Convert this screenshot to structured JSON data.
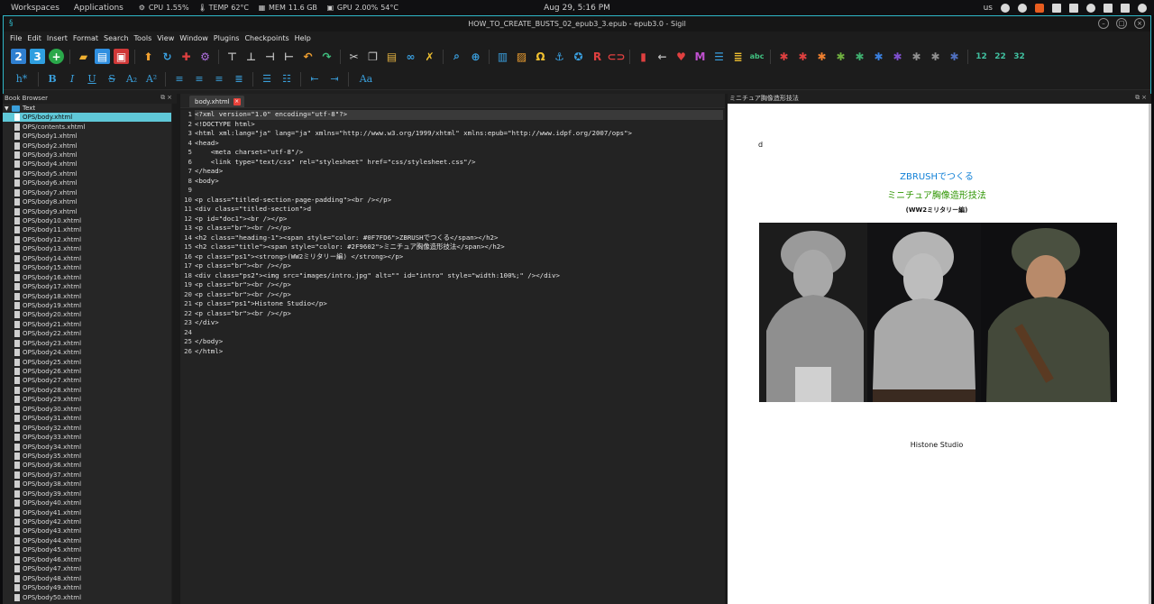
{
  "sysbar": {
    "workspaces": "Workspaces",
    "applications": "Applications",
    "cpu_label": "CPU",
    "cpu_value": "1.55%",
    "temp_label": "TEMP",
    "temp_value": "62°C",
    "mem_label": "MEM",
    "mem_value": "11.6 GB",
    "gpu_label": "GPU",
    "gpu_value": "2.00%",
    "gpu_temp": "54°C",
    "clock": "Aug 29, 5:16 PM",
    "keyboard": "us"
  },
  "window": {
    "title": "HOW_TO_CREATE_BUSTS_02_epub3_3.epub - epub3.0 - Sigil"
  },
  "menu": [
    "File",
    "Edit",
    "Insert",
    "Format",
    "Search",
    "Tools",
    "View",
    "Window",
    "Plugins",
    "Checkpoints",
    "Help"
  ],
  "toolbar2": {
    "heading": "h*",
    "bold": "B",
    "italic": "I",
    "underline": "U",
    "strike": "S",
    "sub": "A₂",
    "sup": "A²",
    "case": "Aa"
  },
  "bookbrowser": {
    "title": "Book Browser",
    "folder": "Text",
    "files": [
      "OPS/body.xhtml",
      "OPS/contents.xhtml",
      "OPS/body1.xhtml",
      "OPS/body2.xhtml",
      "OPS/body3.xhtml",
      "OPS/body4.xhtml",
      "OPS/body5.xhtml",
      "OPS/body6.xhtml",
      "OPS/body7.xhtml",
      "OPS/body8.xhtml",
      "OPS/body9.xhtml",
      "OPS/body10.xhtml",
      "OPS/body11.xhtml",
      "OPS/body12.xhtml",
      "OPS/body13.xhtml",
      "OPS/body14.xhtml",
      "OPS/body15.xhtml",
      "OPS/body16.xhtml",
      "OPS/body17.xhtml",
      "OPS/body18.xhtml",
      "OPS/body19.xhtml",
      "OPS/body20.xhtml",
      "OPS/body21.xhtml",
      "OPS/body22.xhtml",
      "OPS/body23.xhtml",
      "OPS/body24.xhtml",
      "OPS/body25.xhtml",
      "OPS/body26.xhtml",
      "OPS/body27.xhtml",
      "OPS/body28.xhtml",
      "OPS/body29.xhtml",
      "OPS/body30.xhtml",
      "OPS/body31.xhtml",
      "OPS/body32.xhtml",
      "OPS/body33.xhtml",
      "OPS/body34.xhtml",
      "OPS/body35.xhtml",
      "OPS/body36.xhtml",
      "OPS/body37.xhtml",
      "OPS/body38.xhtml",
      "OPS/body39.xhtml",
      "OPS/body40.xhtml",
      "OPS/body41.xhtml",
      "OPS/body42.xhtml",
      "OPS/body43.xhtml",
      "OPS/body44.xhtml",
      "OPS/body45.xhtml",
      "OPS/body46.xhtml",
      "OPS/body47.xhtml",
      "OPS/body48.xhtml",
      "OPS/body49.xhtml",
      "OPS/body50.xhtml"
    ],
    "selected_index": 0
  },
  "editor": {
    "tab_label": "body.xhtml",
    "current_line": 1,
    "lines": [
      "<?xml version=\"1.0\" encoding=\"utf-8\"?>",
      "<!DOCTYPE html>",
      "<html xml:lang=\"ja\" lang=\"ja\" xmlns=\"http://www.w3.org/1999/xhtml\" xmlns:epub=\"http://www.idpf.org/2007/ops\">",
      "<head>",
      "    <meta charset=\"utf-8\"/>",
      "    <link type=\"text/css\" rel=\"stylesheet\" href=\"css/stylesheet.css\"/>",
      "</head>",
      "<body>",
      "",
      "<p class=\"titled-section-page-padding\"><br /></p>",
      "<div class=\"titled-section\">d",
      "<p id=\"doc1\"><br /></p>",
      "<p class=\"br\"><br /></p>",
      "<h2 class=\"heading-1\"><span style=\"color: #0F7FD6\">ZBRUSHでつくる</span></h2>",
      "<h2 class=\"title\"><span style=\"color: #2F9602\">ミニチュア胸像造形技法</span></h2>",
      "<p class=\"ps1\"><strong>(WW2ミリタリー編) </strong></p>",
      "<p class=\"br\"><br /></p>",
      "<div class=\"ps2\"><img src=\"images/intro.jpg\" alt=\"\" id=\"intro\" style=\"width:100%;\" /></div>",
      "<p class=\"br\"><br /></p>",
      "<p class=\"br\"><br /></p>",
      "<p class=\"ps1\">Histone Studio</p>",
      "<p class=\"br\"><br /></p>",
      "</div>",
      "",
      "</body>",
      "</html>"
    ]
  },
  "preview": {
    "title": "ミニチュア胸像造形技法",
    "text_d": "d",
    "heading1": "ZBRUSHでつくる",
    "heading1_color": "#0F7FD6",
    "title_color": "#2F9602",
    "subtitle": "(WW2ミリタリー編)",
    "studio": "Histone Studio"
  },
  "colors": {
    "accent": "#2fb8c8",
    "selected_row": "#5fc8d8"
  }
}
